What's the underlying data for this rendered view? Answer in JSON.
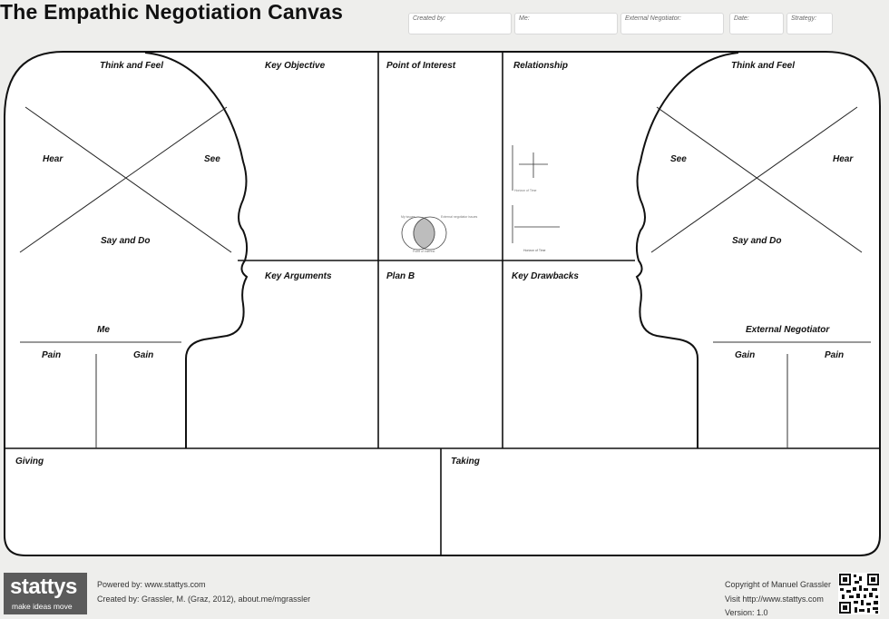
{
  "title": "The Empathic Negotiation Canvas",
  "header_fields": {
    "created_by": "Created by:",
    "me": "Me:",
    "external_negotiator": "External Negotiator:",
    "date": "Date:",
    "strategy": "Strategy:"
  },
  "sections": {
    "left_think_feel": "Think and Feel",
    "left_hear": "Hear",
    "left_see": "See",
    "left_say_do": "Say and Do",
    "me": "Me",
    "left_pain": "Pain",
    "left_gain": "Gain",
    "key_objective": "Key Objective",
    "point_of_interest": "Point of Interest",
    "relationship": "Relationship",
    "key_arguments": "Key Arguments",
    "plan_b": "Plan B",
    "key_drawbacks": "Key Drawbacks",
    "right_think_feel": "Think and Feel",
    "right_see": "See",
    "right_hear": "Hear",
    "right_say_do": "Say and Do",
    "external_negotiator": "External Negotiator",
    "right_gain": "Gain",
    "right_pain": "Pain",
    "giving": "Giving",
    "taking": "Taking"
  },
  "diagrams": {
    "quadrant_x_axis": "Horizon of Time",
    "venn_left": "My issues",
    "venn_right": "External negotiator issues",
    "venn_bottom": "Point of interest",
    "line_x_axis": "Horizon of Time"
  },
  "footer": {
    "logo_word": "stattys",
    "logo_tagline": "make ideas move",
    "powered_by": "Powered by: www.stattys.com",
    "created_by": "Created by: Grassler, M. (Graz, 2012), about.me/mgrassler",
    "copyright": "Copyright of Manuel Grassler",
    "visit": "Visit http://www.stattys.com",
    "version": "Version: 1.0"
  }
}
